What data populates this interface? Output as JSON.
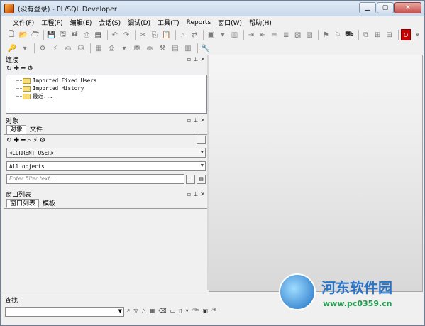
{
  "window": {
    "title": "(没有登录) - PL/SQL Developer",
    "controls": [
      "minimize",
      "maximize",
      "close"
    ]
  },
  "menu": [
    "文件(F)",
    "工程(P)",
    "编辑(E)",
    "会话(S)",
    "调试(D)",
    "工具(T)",
    "Reports",
    "窗口(W)",
    "帮助(H)"
  ],
  "connection_panel": {
    "title": "连接",
    "items": [
      "Imported Fixed Users",
      "Imported History",
      "最近..."
    ]
  },
  "objects_panel": {
    "title": "对象",
    "tabs": [
      "对象",
      "文件"
    ],
    "user_combo": "<CURRENT USER>",
    "filter_combo": "All objects",
    "filter_placeholder": "Enter filter text...",
    "filter_button": "..."
  },
  "window_list_panel": {
    "title": "窗口列表",
    "tabs": [
      "窗口列表",
      "模板"
    ]
  },
  "find_bar": {
    "label": "查找"
  },
  "watermark": {
    "title": "河东软件园",
    "url": "www.pc0359.cn"
  },
  "colors": {
    "titlebar": "#c9d9ec",
    "workspace": "#e6e6e6",
    "watermark_blue": "#2a74c8",
    "watermark_green": "#1f9c4c"
  }
}
